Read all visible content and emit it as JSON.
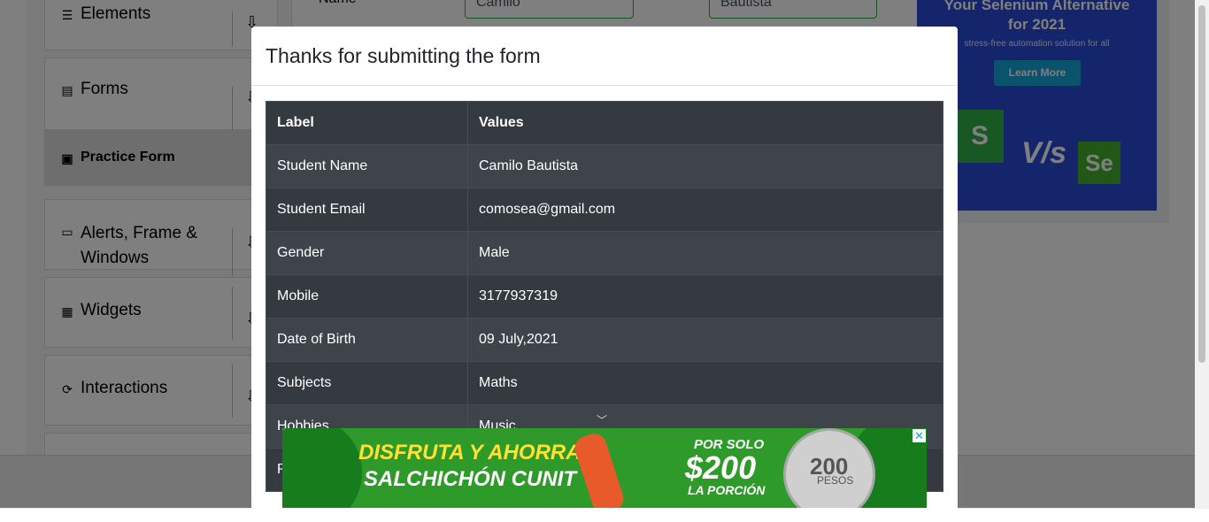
{
  "sidebar": {
    "groups": [
      {
        "label": "Elements",
        "icon": "list-icon"
      },
      {
        "label": "Forms",
        "icon": "document-icon",
        "active_child": "Practice Form"
      },
      {
        "label": "Alerts, Frame & Windows",
        "icon": "window-icon"
      },
      {
        "label": "Widgets",
        "icon": "widgets-icon"
      },
      {
        "label": "Interactions",
        "icon": "interactions-icon"
      }
    ]
  },
  "form": {
    "name_label": "Name",
    "first_name": "Camilo",
    "last_name": "Bautista"
  },
  "ad_right": {
    "line1": "Your Selenium Alternative",
    "line2": "for 2021",
    "line3": "stress-free automation solution for all",
    "button": "Learn More",
    "logo1": "S",
    "vs": "V/s",
    "logo2": "Se"
  },
  "modal": {
    "title": "Thanks for submitting the form",
    "headers": [
      "Label",
      "Values"
    ],
    "rows": [
      {
        "label": "Student Name",
        "value": "Camilo Bautista"
      },
      {
        "label": "Student Email",
        "value": "comosea@gmail.com"
      },
      {
        "label": "Gender",
        "value": "Male"
      },
      {
        "label": "Mobile",
        "value": "3177937319"
      },
      {
        "label": "Date of Birth",
        "value": "09 July,2021"
      },
      {
        "label": "Subjects",
        "value": "Maths"
      },
      {
        "label": "Hobbies",
        "value": "Music"
      },
      {
        "label": "P",
        "value": ""
      }
    ]
  },
  "ad_bottom": {
    "line1": "DISFRUTA Y AHORRA",
    "line2": "SALCHICHÓN CUNIT",
    "price_prefix": "POR SOLO",
    "price": "$200",
    "price_suffix": "LA PORCIÓN",
    "coin_value": "200",
    "coin_text": "PESOS",
    "close": "✕"
  },
  "colors": {
    "overlay": "rgba(0,0,0,0.5)",
    "table_dark": "#343a40",
    "table_odd": "#3e444a",
    "success": "#28a745"
  }
}
